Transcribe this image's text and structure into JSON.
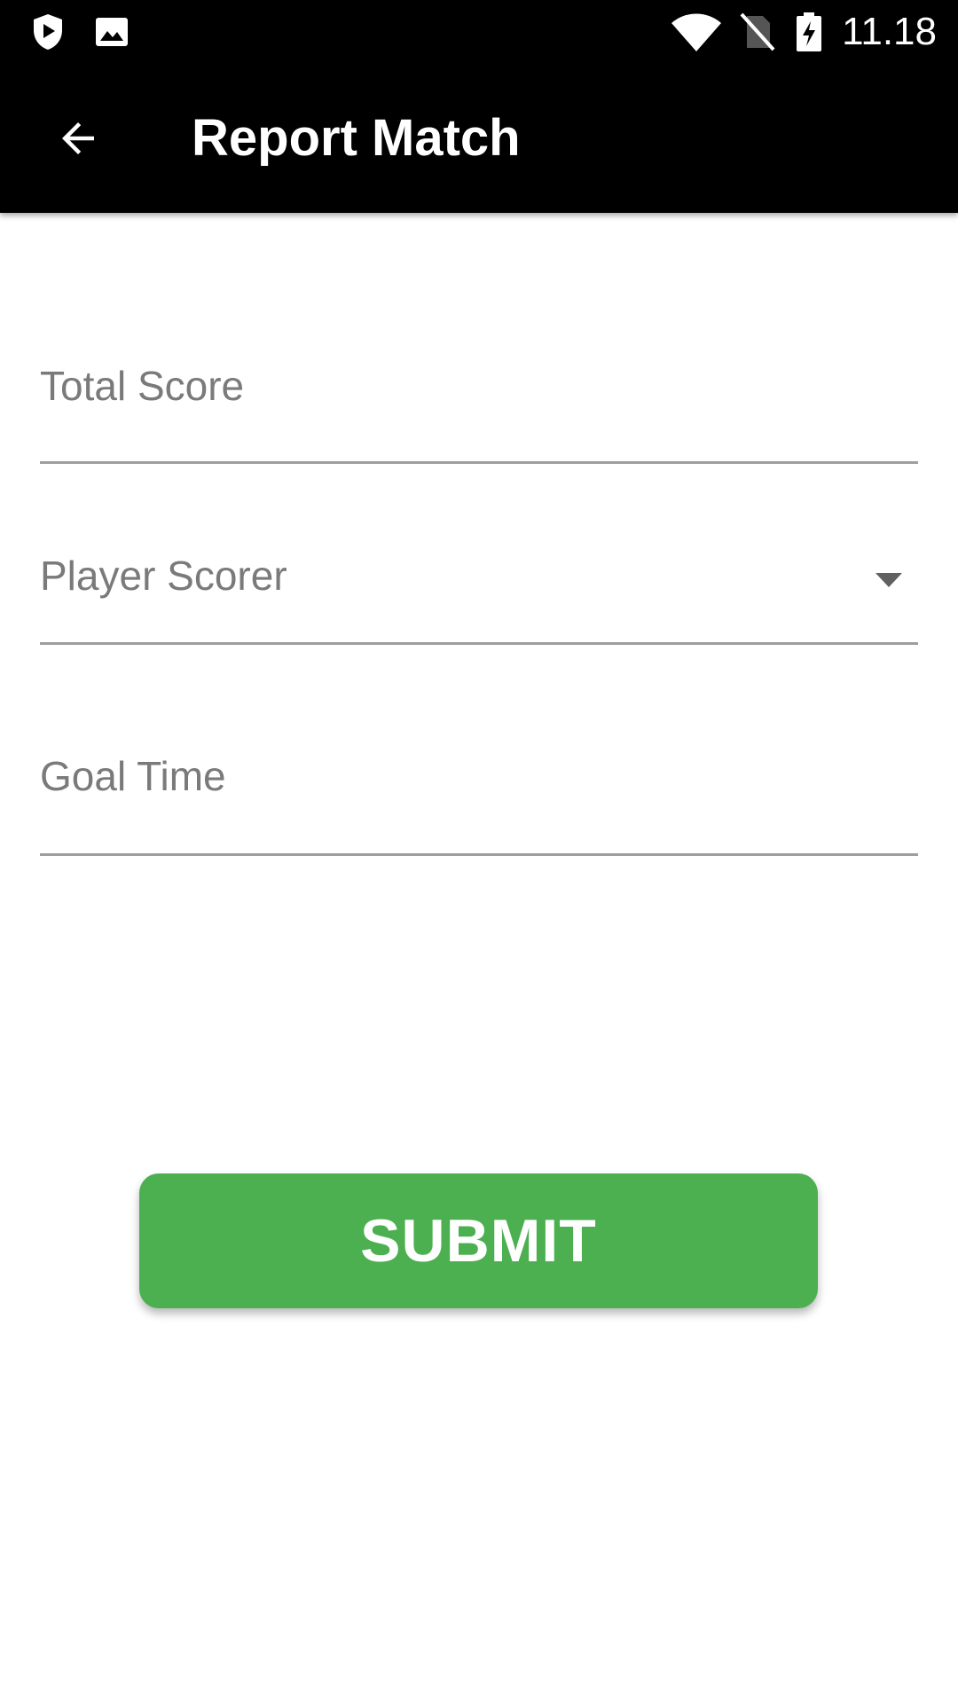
{
  "status_bar": {
    "time": "11.18",
    "icons": [
      "shield-play-icon",
      "image-icon",
      "wifi-icon",
      "no-sim-icon",
      "battery-charging-icon"
    ]
  },
  "app_bar": {
    "title": "Report Match",
    "back_icon": "arrow-back-icon"
  },
  "form": {
    "total_score_placeholder": "Total Score",
    "player_scorer_label": "Player Scorer",
    "goal_time_placeholder": "Goal Time",
    "submit_label": "SUBMIT"
  },
  "colors": {
    "app_bar": "#000000",
    "submit_button": "#4caf50",
    "underline": "#9e9e9e",
    "hint_text": "#7a7a7a"
  }
}
